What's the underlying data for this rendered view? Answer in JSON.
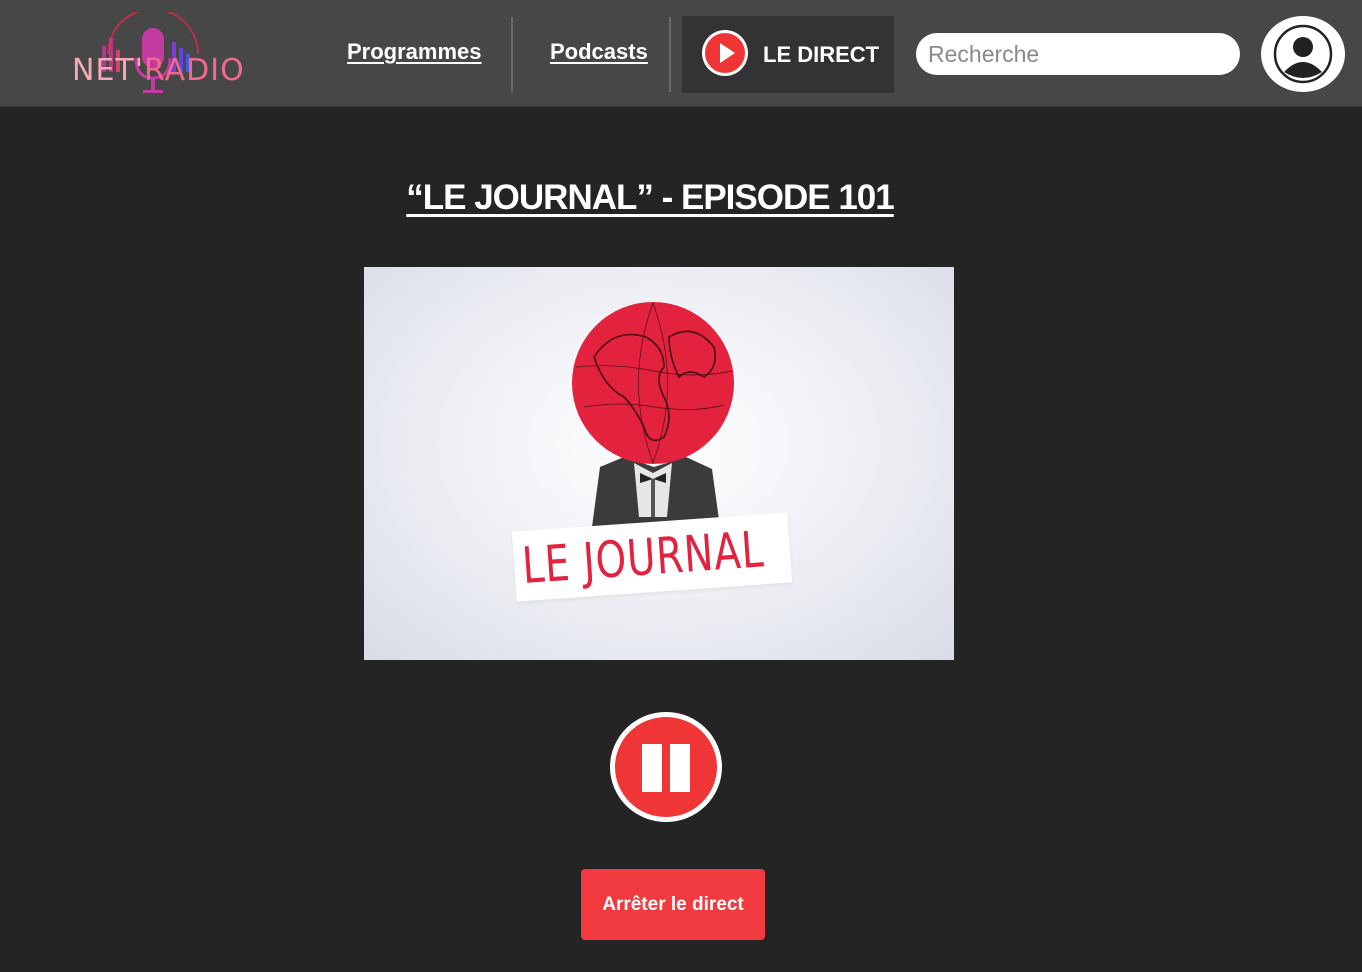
{
  "header": {
    "logo": {
      "part1": "NET'",
      "part2": "RADIO"
    },
    "nav": {
      "programmes": "Programmes",
      "podcasts": "Podcasts"
    },
    "live": {
      "label": "LE DIRECT",
      "icon": "play-circle-icon"
    },
    "search": {
      "placeholder": "Recherche",
      "value": ""
    },
    "account": {
      "icon": "user-avatar-icon"
    }
  },
  "main": {
    "title": "“LE JOURNAL” - EPISODE 101",
    "cover": {
      "text": "LE JOURNAL"
    },
    "player": {
      "state": "playing",
      "icon": "pause-icon"
    },
    "stop_label": "Arrêter le direct"
  },
  "colors": {
    "header_bg": "#474747",
    "page_bg": "#242424",
    "accent_red": "#ef3535",
    "logo_pink": "#f7a8b8"
  }
}
